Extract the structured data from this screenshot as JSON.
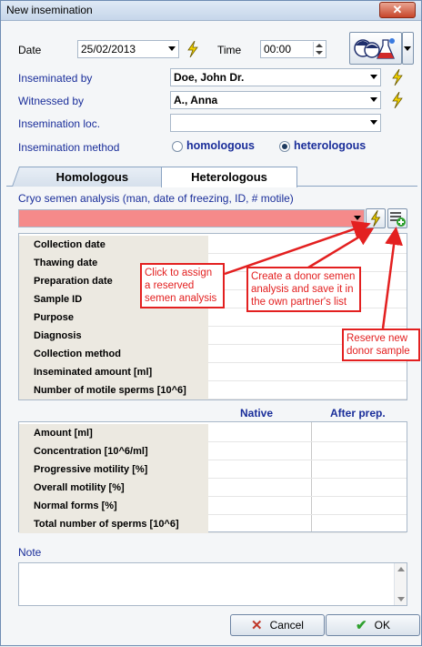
{
  "window": {
    "title": "New insemination",
    "close_label": "✕"
  },
  "form": {
    "date_label": "Date",
    "date_value": "25/02/2013",
    "time_label": "Time",
    "time_value": "00:00",
    "inseminated_by_label": "Inseminated by",
    "inseminated_by_value": "Doe, John Dr.",
    "witnessed_by_label": "Witnessed by",
    "witnessed_by_value": "A., Anna",
    "location_label": "Insemination loc.",
    "location_value": "",
    "method_label": "Insemination method",
    "method_options": [
      {
        "label": "homologous",
        "selected": false
      },
      {
        "label": "heterologous",
        "selected": true
      }
    ]
  },
  "tabs": [
    {
      "label": "Homologous",
      "active": false
    },
    {
      "label": "Heterologous",
      "active": true
    }
  ],
  "cryo": {
    "label": "Cryo semen analysis (man, date of freezing, ID, # motile)",
    "value": "",
    "field_color": "#f58a8a"
  },
  "details_rows": [
    "Collection date",
    "Thawing date",
    "Preparation date",
    "Sample ID",
    "Purpose",
    "Diagnosis",
    "Collection method",
    "Inseminated amount [ml]",
    "Number of motile sperms [10^6]"
  ],
  "results": {
    "col_native": "Native",
    "col_after": "After prep.",
    "rows": [
      "Amount [ml]",
      "Concentration [10^6/ml]",
      "Progressive motility [%]",
      "Overall motility [%]",
      "Normal forms [%]",
      "Total number of sperms [10^6]"
    ]
  },
  "note_label": "Note",
  "note_value": "",
  "buttons": {
    "cancel": "Cancel",
    "ok": "OK"
  },
  "callouts": {
    "assign": "Click to assign a reserved semen analysis",
    "create": "Create a donor semen analysis and save it in the own partner's list",
    "reserve": "Reserve new donor sample"
  },
  "colors": {
    "accent_red": "#e32020",
    "label_blue": "#1a2e9a"
  },
  "icons": [
    "bolt-icon",
    "couple-lab-icon",
    "add-list-icon",
    "cancel-x-icon",
    "ok-check-icon"
  ]
}
